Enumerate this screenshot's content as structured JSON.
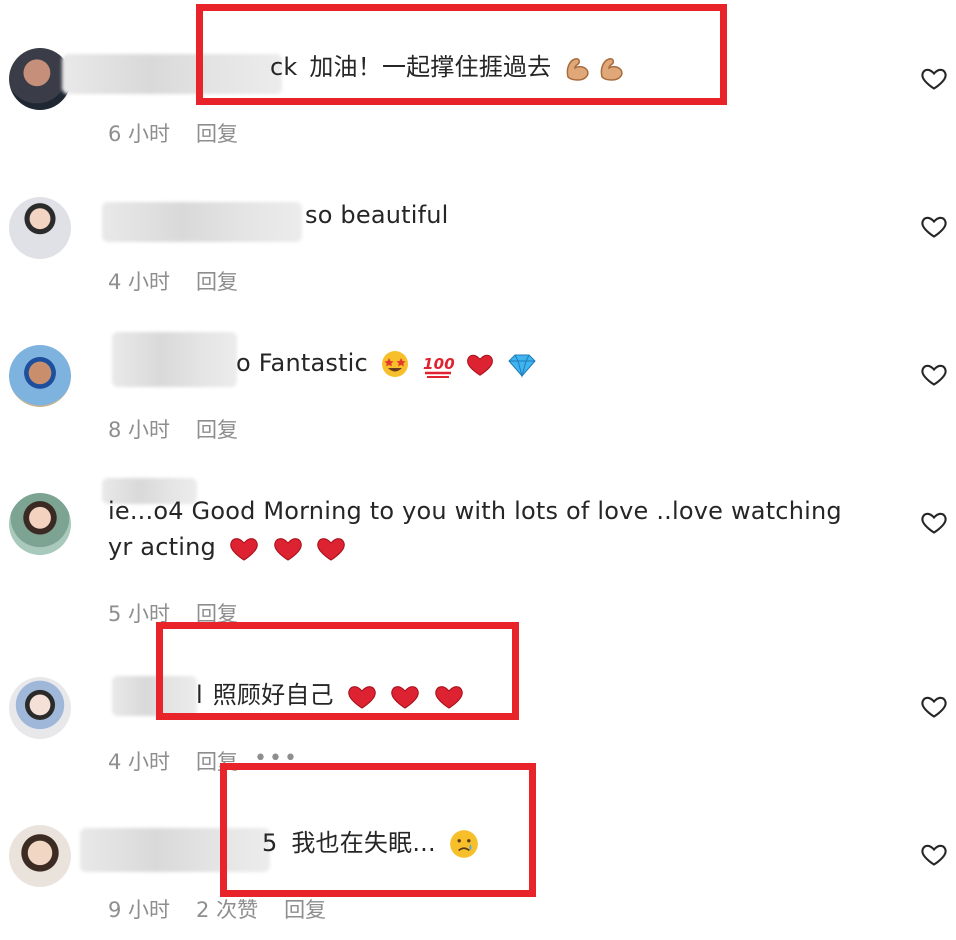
{
  "comments": [
    {
      "id": "c1",
      "username_tail": "ck",
      "text": "加油！一起撑住捱過去",
      "emoji": [
        "flexed-biceps",
        "flexed-biceps"
      ],
      "time": "6 小时",
      "reply_label": "回复",
      "likes_label": ""
    },
    {
      "id": "c2",
      "username_tail": "",
      "text": "so beautiful",
      "emoji": [],
      "time": "4 小时",
      "reply_label": "回复",
      "likes_label": ""
    },
    {
      "id": "c3",
      "username_tail": "o",
      "text": "Fantastic",
      "emoji": [
        "star-struck-face",
        "hundred-points",
        "red-heart",
        "gem-stone"
      ],
      "time": "8 小时",
      "reply_label": "回复",
      "likes_label": ""
    },
    {
      "id": "c4",
      "username_tail": "ie...o4",
      "text": "Good Morning to you with lots of love ..love watching",
      "text_line2": "yr acting",
      "emoji": [
        "red-heart",
        "red-heart",
        "red-heart"
      ],
      "time": "5 小时",
      "reply_label": "回复",
      "likes_label": ""
    },
    {
      "id": "c5",
      "username_tail": "l",
      "text": "照顾好自己",
      "emoji": [
        "red-heart",
        "red-heart",
        "red-heart"
      ],
      "time": "4 小时",
      "reply_label": "回复",
      "likes_label": "",
      "more": "•••"
    },
    {
      "id": "c6",
      "username_tail": "5",
      "text": "我也在失眠...",
      "emoji": [
        "crying-face"
      ],
      "time": "9 小时",
      "reply_label": "回复",
      "likes_label": "2 次赞"
    }
  ],
  "icons": {
    "like": "heart-outline-icon"
  },
  "colors": {
    "highlight": "#e8232a",
    "meta_text": "#8e8e8e",
    "body_text": "#262626"
  }
}
